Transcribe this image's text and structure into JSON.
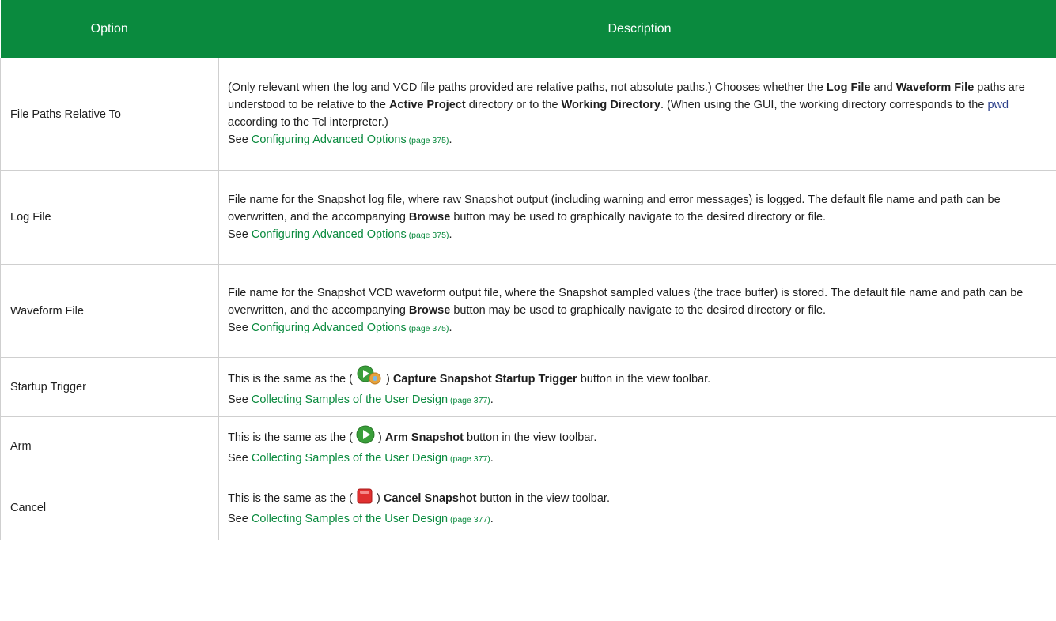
{
  "header": {
    "option": "Option",
    "description": "Description"
  },
  "rows": [
    {
      "option": "File Paths Relative To",
      "t1": "(Only relevant when the log and VCD file paths provided are relative paths, not absolute paths.) Chooses whether the ",
      "b1": "Log File",
      "t2": " and ",
      "b2": "Waveform File",
      "t3": " paths are understood to be relative to the ",
      "b3": "Active Project",
      "t4": " directory or to the ",
      "b4": "Working Directory",
      "t5": ".  (When using the GUI, the working directory corresponds to the ",
      "code": "pwd",
      "t6": " according to the Tcl interpreter.)",
      "see": "See ",
      "link": "Configuring Advanced Options",
      "page": " (page 375)",
      "end": "."
    },
    {
      "option": "Log File",
      "t1": "File name for the Snapshot log file, where raw Snapshot output (including warning and error messages) is logged. The default file name and path can be overwritten, and the accompanying ",
      "b1": "Browse",
      "t2": " button may be used to graphically navigate to the desired directory or file.",
      "see": "See ",
      "link": "Configuring Advanced Options",
      "page": " (page 375)",
      "end": "."
    },
    {
      "option": "Waveform File",
      "t1": "File name for the Snapshot VCD waveform output file, where the Snapshot sampled values (the trace buffer) is stored. The default file name and path can be overwritten, and the accompanying ",
      "b1": "Browse",
      "t2": " button may be used to graphically navigate to the desired directory or file.",
      "see": "See ",
      "link": "Configuring Advanced Options",
      "page": " (page 375)",
      "end": "."
    },
    {
      "option": "Startup Trigger",
      "t1": "This is the same as the ( ",
      "icon": "capture-startup-trigger-icon",
      "t2": " ) ",
      "b1": "Capture Snapshot Startup Trigger",
      "t3": " button in the view toolbar.",
      "see": "See ",
      "link": "Collecting Samples of the User Design",
      "page": " (page 377)",
      "end": "."
    },
    {
      "option": "Arm",
      "t1": "This is the same as the ( ",
      "icon": "arm-snapshot-icon",
      "t2": " ) ",
      "b1": "Arm Snapshot",
      "t3": " button in the view toolbar.",
      "see": "See ",
      "link": "Collecting Samples of the User Design",
      "page": " (page 377)",
      "end": "."
    },
    {
      "option": "Cancel",
      "t1": "This is the same as the ( ",
      "icon": "cancel-snapshot-icon",
      "t2": " ) ",
      "b1": "Cancel Snapshot",
      "t3": " button in the view toolbar.",
      "see": "See ",
      "link": "Collecting Samples of the User Design",
      "page": " (page 377)",
      "end": "."
    }
  ],
  "colors": {
    "header_bg": "#0a8a3e",
    "link": "#0a8a3e",
    "code": "#2b3f8a",
    "border": "#cfcfcf"
  }
}
